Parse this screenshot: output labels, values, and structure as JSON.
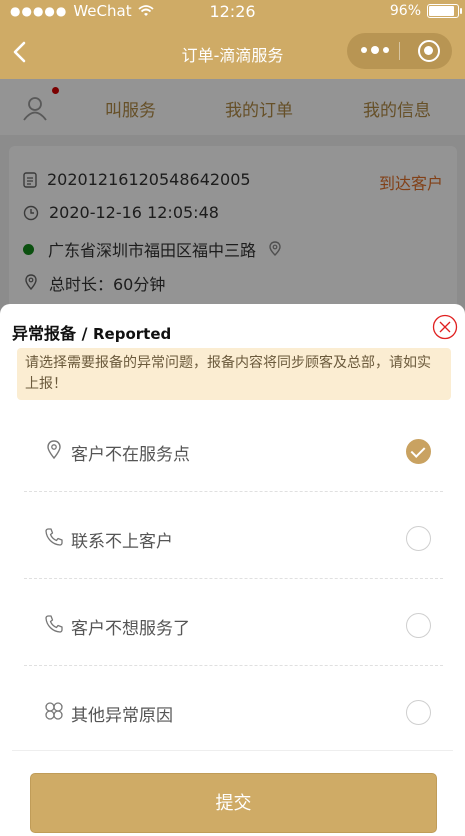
{
  "status_bar": {
    "signal": "●●●●●",
    "carrier": "WeChat",
    "time": "12:26",
    "battery": "96%",
    "battery_level": 0.96
  },
  "nav": {
    "title": "订单-滴滴服务"
  },
  "tabs": [
    "叫服务",
    "我的订单",
    "我的信息"
  ],
  "order": {
    "order_no": "20201216120548642005",
    "status": "到达客户",
    "datetime": "2020-12-16 12:05:48",
    "address": "广东省深圳市福田区福中三路",
    "duration": "总时长：60分钟"
  },
  "dialog": {
    "title_cn": "异常报备",
    "title_sep": " / ",
    "title_en": "Reported",
    "notice": "请选择需要报备的异常问题，报备内容将同步顾客及总部，请如实上报！",
    "options": [
      {
        "label": "客户不在服务点",
        "icon": "location-pin-icon",
        "selected": true
      },
      {
        "label": "联系不上客户",
        "icon": "phone-icon",
        "selected": false
      },
      {
        "label": "客户不想服务了",
        "icon": "phone-icon",
        "selected": false
      },
      {
        "label": "其他异常原因",
        "icon": "clover-icon",
        "selected": false
      }
    ],
    "submit_label": "提交"
  },
  "colors": {
    "brand": "#cfab66",
    "notice_bg": "#fbedd2",
    "status_orange": "#e0702a",
    "close_red": "#e02020"
  }
}
